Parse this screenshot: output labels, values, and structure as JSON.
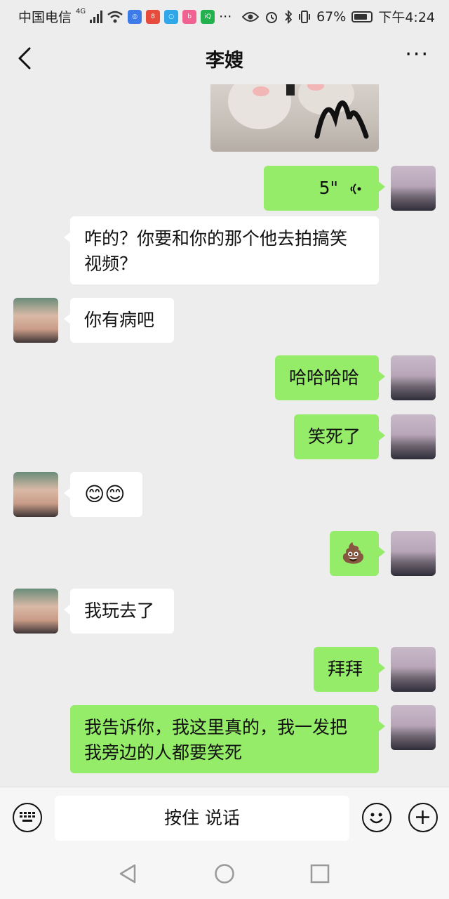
{
  "status": {
    "carrier": "中国电信",
    "network": "4G",
    "battery": "67%",
    "time": "下午4:24"
  },
  "header": {
    "title": "李嫂",
    "back_icon": "chevron-left-icon",
    "more_label": "···"
  },
  "messages": [
    {
      "from": "me",
      "type": "voice",
      "text": "5\""
    },
    {
      "from": "her",
      "type": "text",
      "line1": "咋的？你要和你的那个他去拍搞笑",
      "line2": "视频？"
    },
    {
      "from": "her",
      "type": "text",
      "text": "你有病吧"
    },
    {
      "from": "me",
      "type": "text",
      "text": "哈哈哈哈"
    },
    {
      "from": "me",
      "type": "text",
      "text": "笑死了"
    },
    {
      "from": "her",
      "type": "emoji",
      "text": "😊😊"
    },
    {
      "from": "me",
      "type": "emoji",
      "text": "💩"
    },
    {
      "from": "her",
      "type": "text",
      "text": "我玩去了"
    },
    {
      "from": "me",
      "type": "text",
      "text": "拜拜"
    },
    {
      "from": "me",
      "type": "text",
      "line1": "我告诉你，我这里真的，我一发把",
      "line2": "我旁边的人都要笑死"
    }
  ],
  "input": {
    "hold_to_talk": "按住 说话"
  },
  "colors": {
    "my_bubble": "#95ec69",
    "their_bubble": "#ffffff",
    "background": "#ededed"
  }
}
